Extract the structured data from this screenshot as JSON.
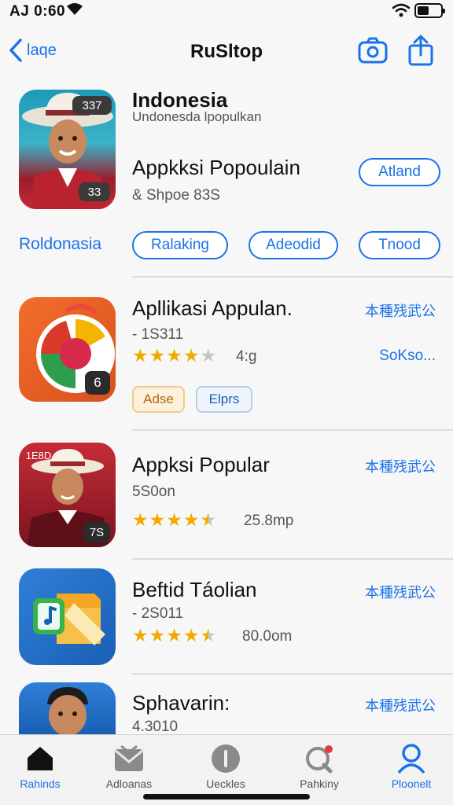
{
  "status_bar": {
    "time": "AJ 0:60"
  },
  "nav": {
    "back_label": "laqe",
    "title": "RuSltop"
  },
  "hero": {
    "icon_badge_top": "337",
    "icon_badge_bottom": "33",
    "title": "Indonesia",
    "subtitle": "Undonesda lpopulkan",
    "app_name": "Appkksi Popoulain",
    "meta": "& Shpoe 83S",
    "button": "Atland"
  },
  "chips": {
    "label": "Roldonasia",
    "items": [
      "Ralaking",
      "Adeodid",
      "Tnood"
    ]
  },
  "apps": [
    {
      "title": "Apllikasi Appulan.",
      "sub": "- 1S311",
      "rating": 4,
      "rating_text": "4:g",
      "get": "本種残武公",
      "extra": "SoKso...",
      "badge": "6",
      "tags": [
        "Adse",
        "Elprs"
      ],
      "colors": {
        "bg1": "#f06a2a",
        "bg2": "#d9501e"
      }
    },
    {
      "title": "Appksi Popular",
      "sub": "5S0on",
      "rating": 4.5,
      "rating_text": "25.8mp",
      "get": "本種残武公",
      "badge_top": "1E8D",
      "badge": "7S",
      "colors": {
        "bg1": "#b8232f",
        "bg2": "#7a1420"
      }
    },
    {
      "title": "Beftid Táolian",
      "sub": "- 2S011",
      "rating": 4.5,
      "rating_text": "80.0om",
      "get": "本種残武公",
      "colors": {
        "bg1": "#2f7fd8",
        "bg2": "#1a5fb4"
      }
    },
    {
      "title": "Sphavarin:",
      "sub": "4.3010",
      "get": "本種残武公",
      "colors": {
        "bg1": "#2f7fd8",
        "bg2": "#1a5fb4"
      }
    }
  ],
  "tabs": [
    {
      "label": "Rahinds",
      "icon": "home-icon",
      "active": true
    },
    {
      "label": "Adloanas",
      "icon": "mail-icon",
      "active": false
    },
    {
      "label": "Ueckles",
      "icon": "info-icon",
      "active": false
    },
    {
      "label": "Pahkiny",
      "icon": "notification-icon",
      "active": false
    },
    {
      "label": "Ploonelt",
      "icon": "profile-icon",
      "active": true
    }
  ],
  "accent_color": "#1a73e8",
  "star_color": "#f2a900"
}
